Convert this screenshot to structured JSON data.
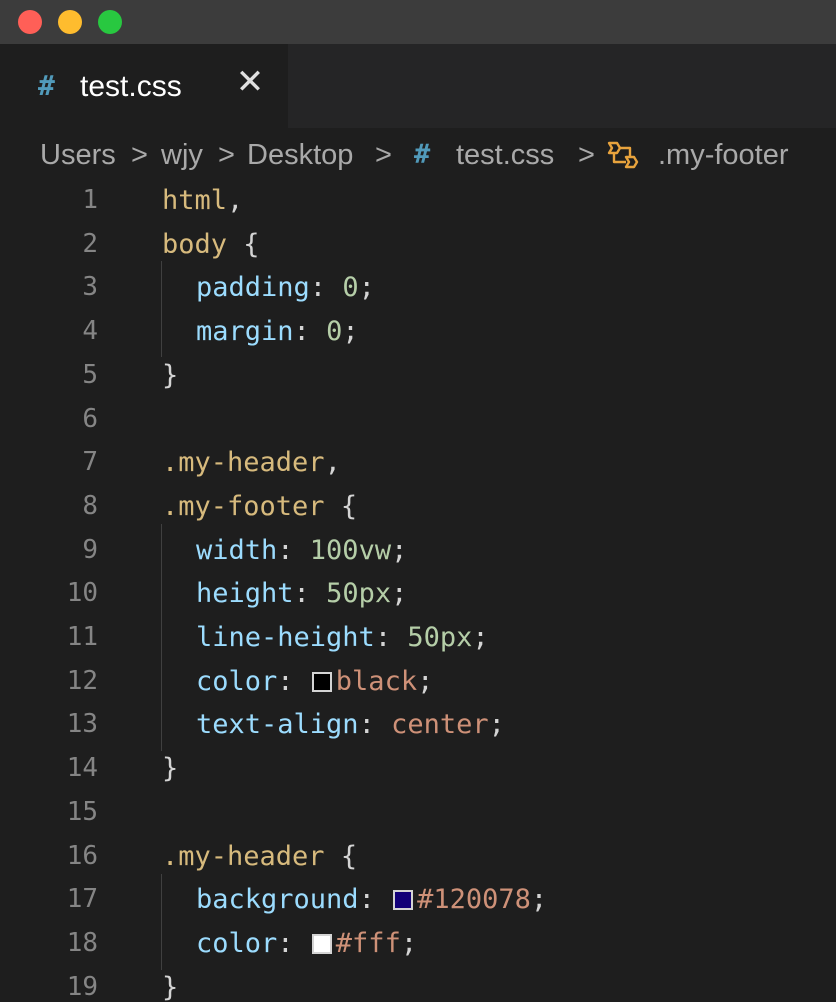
{
  "window": {
    "traffic_lights": [
      "close",
      "minimize",
      "zoom"
    ],
    "colors": {
      "close": "#ff5f57",
      "minimize": "#febc2e",
      "zoom": "#28c840"
    }
  },
  "tab": {
    "icon": "#",
    "label": "test.css",
    "close_glyph": "✕"
  },
  "breadcrumbs": {
    "items": [
      "Users",
      "wjy",
      "Desktop",
      "test.css",
      ".my-footer"
    ],
    "separator": ">",
    "file_icon": "#",
    "symbol_icon": "css-selector-icon"
  },
  "editor": {
    "language": "css",
    "lines": [
      {
        "n": "1",
        "tokens": [
          {
            "t": "html",
            "c": "sel"
          },
          {
            "t": ",",
            "c": "punc"
          }
        ]
      },
      {
        "n": "2",
        "tokens": [
          {
            "t": "body",
            "c": "sel"
          },
          {
            "t": " {",
            "c": "punc"
          }
        ]
      },
      {
        "n": "3",
        "indent": true,
        "tokens": [
          {
            "t": "padding",
            "c": "prop"
          },
          {
            "t": ": ",
            "c": "punc"
          },
          {
            "t": "0",
            "c": "num"
          },
          {
            "t": ";",
            "c": "punc"
          }
        ]
      },
      {
        "n": "4",
        "indent": true,
        "tokens": [
          {
            "t": "margin",
            "c": "prop"
          },
          {
            "t": ": ",
            "c": "punc"
          },
          {
            "t": "0",
            "c": "num"
          },
          {
            "t": ";",
            "c": "punc"
          }
        ]
      },
      {
        "n": "5",
        "tokens": [
          {
            "t": "}",
            "c": "punc"
          }
        ]
      },
      {
        "n": "6",
        "tokens": []
      },
      {
        "n": "7",
        "tokens": [
          {
            "t": ".my-header",
            "c": "sel"
          },
          {
            "t": ",",
            "c": "punc"
          }
        ]
      },
      {
        "n": "8",
        "tokens": [
          {
            "t": ".my-footer",
            "c": "sel"
          },
          {
            "t": " {",
            "c": "punc"
          }
        ]
      },
      {
        "n": "9",
        "indent": true,
        "tokens": [
          {
            "t": "width",
            "c": "prop"
          },
          {
            "t": ": ",
            "c": "punc"
          },
          {
            "t": "100vw",
            "c": "num"
          },
          {
            "t": ";",
            "c": "punc"
          }
        ]
      },
      {
        "n": "10",
        "indent": true,
        "tokens": [
          {
            "t": "height",
            "c": "prop"
          },
          {
            "t": ": ",
            "c": "punc"
          },
          {
            "t": "50px",
            "c": "num"
          },
          {
            "t": ";",
            "c": "punc"
          }
        ]
      },
      {
        "n": "11",
        "indent": true,
        "tokens": [
          {
            "t": "line-height",
            "c": "prop"
          },
          {
            "t": ": ",
            "c": "punc"
          },
          {
            "t": "50px",
            "c": "num"
          },
          {
            "t": ";",
            "c": "punc"
          }
        ]
      },
      {
        "n": "12",
        "indent": true,
        "tokens": [
          {
            "t": "color",
            "c": "prop"
          },
          {
            "t": ": ",
            "c": "punc"
          },
          {
            "swatch": "#000000"
          },
          {
            "t": "black",
            "c": "val"
          },
          {
            "t": ";",
            "c": "punc"
          }
        ]
      },
      {
        "n": "13",
        "indent": true,
        "tokens": [
          {
            "t": "text-align",
            "c": "prop"
          },
          {
            "t": ": ",
            "c": "punc"
          },
          {
            "t": "center",
            "c": "val"
          },
          {
            "t": ";",
            "c": "punc"
          }
        ]
      },
      {
        "n": "14",
        "tokens": [
          {
            "t": "}",
            "c": "punc"
          }
        ]
      },
      {
        "n": "15",
        "tokens": []
      },
      {
        "n": "16",
        "tokens": [
          {
            "t": ".my-header",
            "c": "sel"
          },
          {
            "t": " {",
            "c": "punc"
          }
        ]
      },
      {
        "n": "17",
        "indent": true,
        "tokens": [
          {
            "t": "background",
            "c": "prop"
          },
          {
            "t": ": ",
            "c": "punc"
          },
          {
            "swatch": "#120078"
          },
          {
            "t": "#120078",
            "c": "val"
          },
          {
            "t": ";",
            "c": "punc"
          }
        ]
      },
      {
        "n": "18",
        "indent": true,
        "tokens": [
          {
            "t": "color",
            "c": "prop"
          },
          {
            "t": ": ",
            "c": "punc"
          },
          {
            "swatch": "#ffffff"
          },
          {
            "t": "#fff",
            "c": "val"
          },
          {
            "t": ";",
            "c": "punc"
          }
        ]
      },
      {
        "n": "19",
        "tokens": [
          {
            "t": "}",
            "c": "punc"
          }
        ]
      }
    ]
  }
}
